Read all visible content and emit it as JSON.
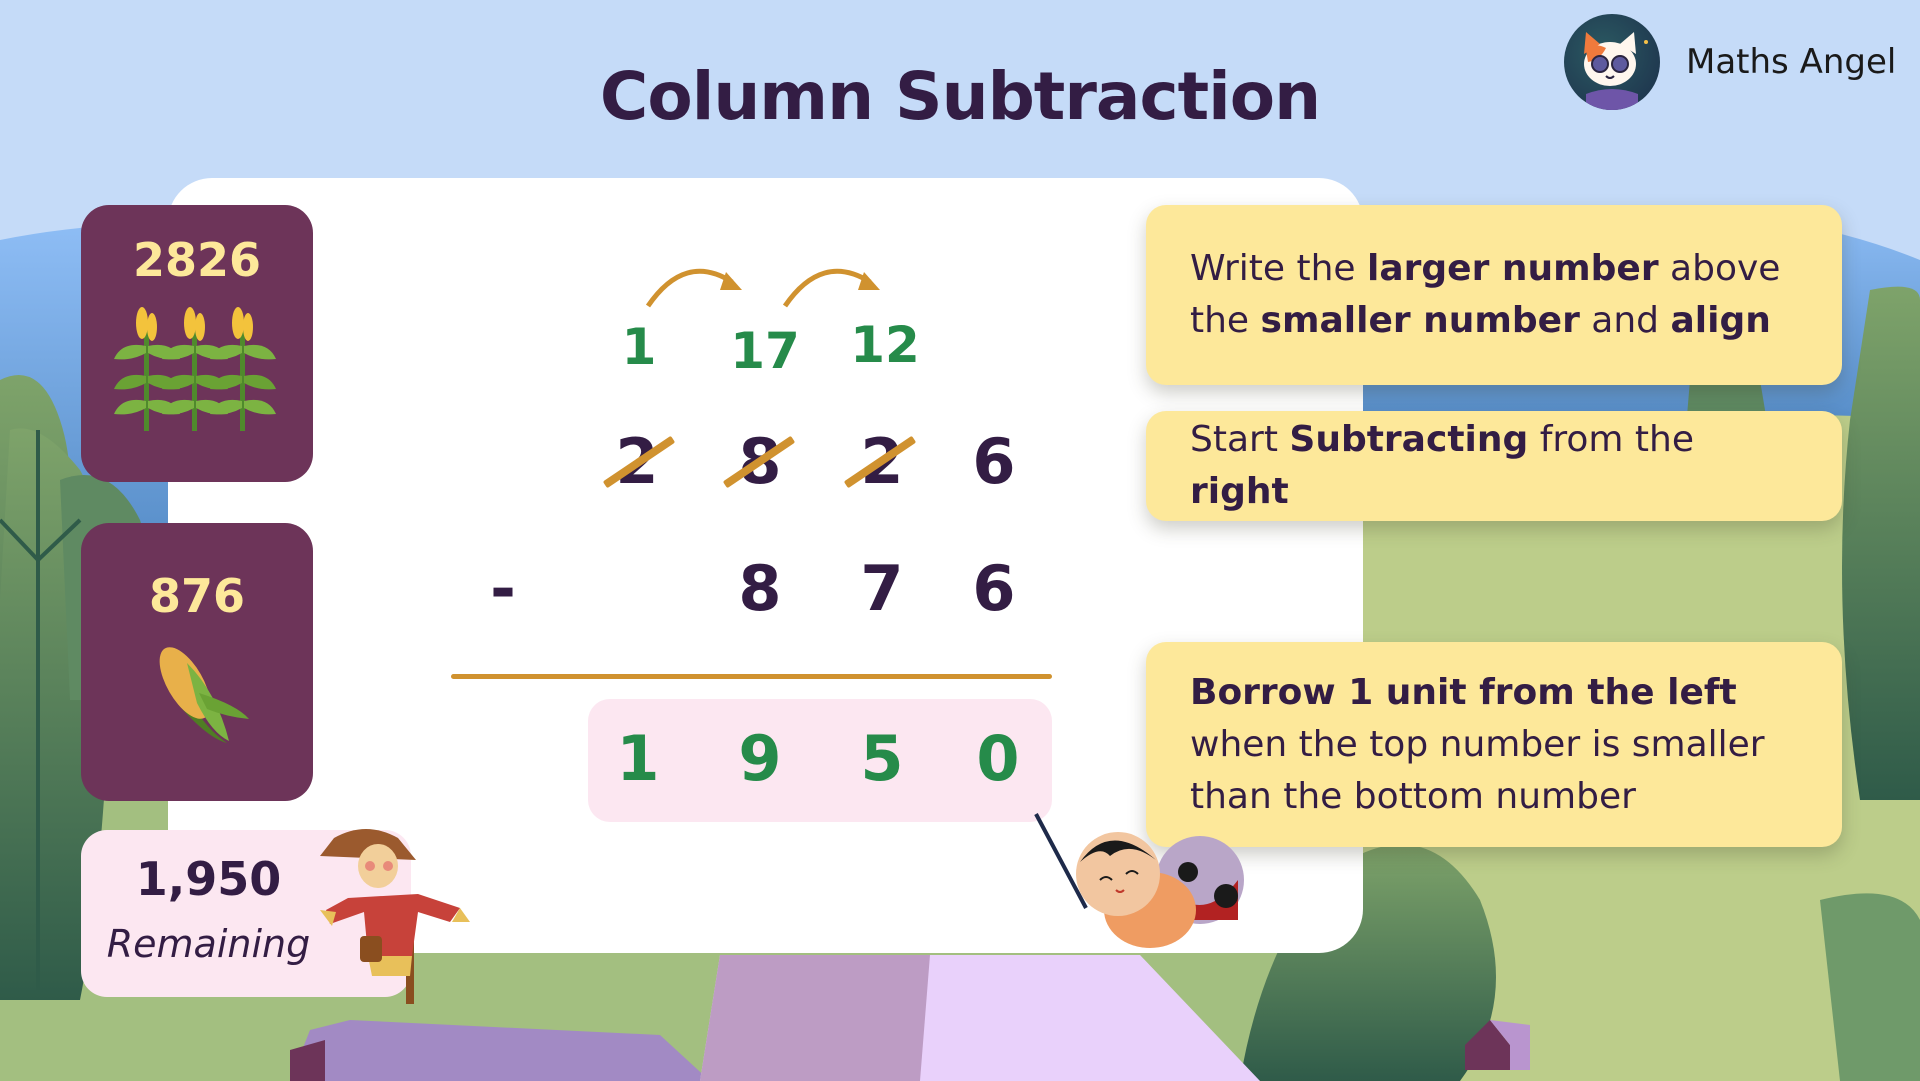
{
  "header": {
    "title": "Column Subtraction",
    "brand_name": "Maths Angel",
    "brand_logo_icon": "cat-with-sunglasses-avatar"
  },
  "colors": {
    "title_text": "#331d44",
    "card_purple": "#6d3459",
    "card_number": "#fde89a",
    "borrow_green": "#268b4a",
    "strike_orange": "#d0922f",
    "answer_bg": "#fce7f1",
    "tip_bg": "#fde89a",
    "sky": "#c5dbf8"
  },
  "cards": {
    "top_number": {
      "value": "2826",
      "icon": "corn-plants-icon"
    },
    "bottom_number": {
      "value": "876",
      "icon": "corn-cob-icon"
    },
    "result": {
      "value": "1,950",
      "label": "Remaining",
      "icon": "scarecrow-icon"
    }
  },
  "calculation": {
    "operator": "-",
    "borrow_values": [
      "1",
      "17",
      "12"
    ],
    "top_digits": [
      {
        "digit": "2",
        "crossed": true
      },
      {
        "digit": "8",
        "crossed": true
      },
      {
        "digit": "2",
        "crossed": true
      },
      {
        "digit": "6",
        "crossed": false
      }
    ],
    "bottom_digits": [
      "",
      "8",
      "7",
      "6"
    ],
    "answer_digits": [
      "1",
      "9",
      "5",
      "0"
    ]
  },
  "tips": [
    {
      "parts": [
        {
          "text": "Write the ",
          "bold": false
        },
        {
          "text": "larger number",
          "bold": true
        },
        {
          "text": " above the ",
          "bold": false
        },
        {
          "text": "smaller number",
          "bold": true
        },
        {
          "text": " and ",
          "bold": false
        },
        {
          "text": "align",
          "bold": true
        }
      ]
    },
    {
      "parts": [
        {
          "text": "Start ",
          "bold": false
        },
        {
          "text": "Subtracting",
          "bold": true
        },
        {
          "text": " from the ",
          "bold": false
        },
        {
          "text": "right",
          "bold": true
        }
      ]
    },
    {
      "parts": [
        {
          "text": "Borrow 1 unit from the left",
          "bold": true
        },
        {
          "text": " when the top number is smaller than the bottom number",
          "bold": false
        }
      ]
    }
  ],
  "mascot": {
    "icon": "ladybug-with-pointer-icon"
  }
}
